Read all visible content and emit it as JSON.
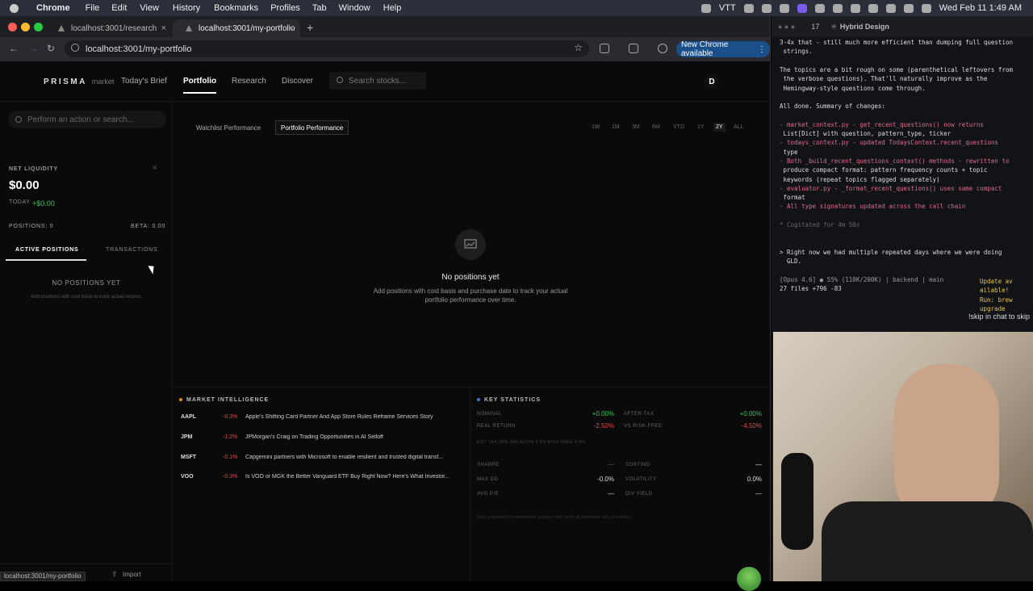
{
  "menubar": {
    "app": "Chrome",
    "items": [
      "File",
      "Edit",
      "View",
      "History",
      "Bookmarks",
      "Profiles",
      "Tab",
      "Window",
      "Help"
    ],
    "right_label": "VTT",
    "clock": "Wed Feb 11  1:49 AM"
  },
  "browser": {
    "tabs": [
      {
        "title": "localhost:3001/research"
      },
      {
        "title": "localhost:3001/my-portfolio"
      }
    ],
    "url": "localhost:3001/my-portfolio",
    "new_chrome": "New Chrome available",
    "status_url": "localhost:3001/my-portfolio"
  },
  "app": {
    "logo": "PRISMA",
    "logo_sub": "market",
    "nav": [
      "Today's Brief",
      "Portfolio",
      "Research",
      "Discover"
    ],
    "active_nav": "Portfolio",
    "stock_search": "Search stocks...",
    "avatar": "D"
  },
  "sidebar": {
    "action_search": "Perform an action or search...",
    "net_liq_label": "NET LIQUIDITY",
    "net_liq": "$0.00",
    "today_label": "TODAY",
    "today_val": "+$0.00",
    "positions_label": "POSITIONS: 0",
    "beta_label": "BETA: 0.00",
    "tabs": [
      "ACTIVE POSITIONS",
      "TRANSACTIONS"
    ],
    "empty_title": "NO POSITIONS YET",
    "empty_sub": "Add positions with cost basis to track actual returns.",
    "import": "Import"
  },
  "perf": {
    "tabs": [
      "Watchlist Performance",
      "Portfolio Performance"
    ],
    "ranges": [
      "1W",
      "1M",
      "3M",
      "6M",
      "YTD",
      "1Y",
      "2Y",
      "ALL"
    ],
    "active_range": "2Y",
    "empty_title": "No positions yet",
    "empty_sub": "Add positions with cost basis and purchase date to track your actual portfolio performance over time."
  },
  "market_intel": {
    "title": "MARKET INTELLIGENCE",
    "rows": [
      {
        "ticker": "AAPL",
        "change": "-0.3%",
        "headline": "Apple's Shifting Card Partner And App Store Rules Reframe Services Story"
      },
      {
        "ticker": "JPM",
        "change": "-1.2%",
        "headline": "JPMorgan's Craig on Trading Opportunities in AI Selloff"
      },
      {
        "ticker": "MSFT",
        "change": "-0.1%",
        "headline": "Capgemini partners with Microsoft to enable resilient and trusted digital transf..."
      },
      {
        "ticker": "VOO",
        "change": "-0.3%",
        "headline": "Is VOO or MGK the Better Vanguard ETF Buy Right Now? Here's What Investor..."
      }
    ]
  },
  "key_stats": {
    "title": "KEY STATISTICS",
    "nominal_label": "NOMINAL",
    "nominal": "+0.00%",
    "after_tax_label": "AFTER-TAX",
    "after_tax": "+0.00%",
    "real_label": "REAL RETURN",
    "real": "-2.50%",
    "vs_rf_label": "VS RISK-FREE",
    "vs_rf": "-4.50%",
    "assumptions": "EST. TAX 30%   INFLATION 2.5%   RISK-FREE 4.5%",
    "sharpe_label": "SHARPE",
    "sharpe": "—",
    "sortino_label": "SORTINO",
    "sortino": "—",
    "maxdd_label": "MAX DD",
    "maxdd": "-0.0%",
    "vol_label": "VOLATILITY",
    "vol": "0.0%",
    "pe_label": "AVG P/E",
    "pe": "—",
    "div_label": "DIV YIELD",
    "div": "—",
    "disclaimer": "Data is provided for informational purposes only. Verify all information with your broker."
  },
  "terminal": {
    "title": "Hybrid Design",
    "tab_num": "17",
    "lines": [
      "3-4x that - still much more efficient than dumping full question",
      " strings.",
      "",
      "The topics are a bit rough on some (parenthetical leftovers from",
      " the verbose questions). That'll naturally improve as the",
      " Hemingway-style questions come through.",
      "",
      "All done. Summary of changes:",
      "",
      "- market_context.py - get_recent_questions() now returns",
      " List[Dict] with question, pattern_type, ticker",
      "- todays_context.py - updated TodaysContext.recent_questions",
      " type",
      "- Both _build_recent_questions_context() methods - rewritten to",
      " produce compact format: pattern frequency counts + topic",
      " keywords (repeat topics flagged separately)",
      "- evaluator.py - _format_recent_questions() uses same compact",
      " format",
      "- All type signatures updated across the call chain",
      "",
      "* Cogitated for 4m 50s",
      "",
      "",
      "> Right now we had multiple repeated days where we were doing",
      "  GLD.",
      "",
      "[Opus 4.6] ● 55% (110K/200K) | backend | main",
      "27 files +796 -83"
    ],
    "update_note": "Update av\nailable!\nRun: brew\nupgrade",
    "skip": "!skip in chat to skip"
  }
}
